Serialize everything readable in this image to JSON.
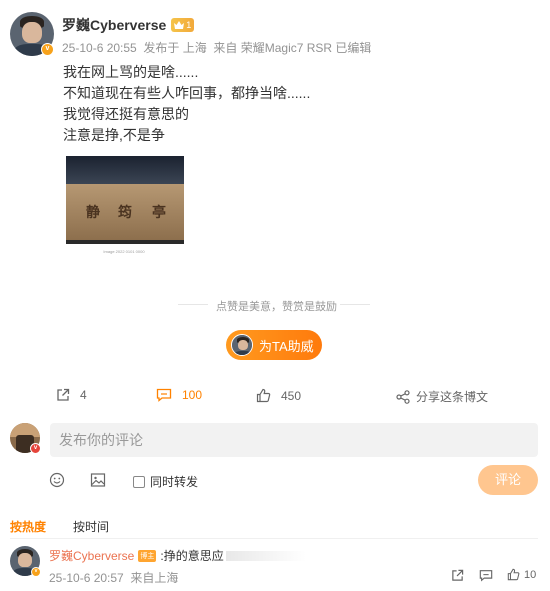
{
  "post": {
    "username": "罗巍Cyberverse",
    "vip_level": "1",
    "meta": "25-10-6 20:55  发布于 上海  来自 荣耀Magic7 RSR 已编辑",
    "lines": [
      "我在网上骂的是啥......",
      "不知道现在有些人咋回事，都挣当啥......",
      "我觉得还挺有意思的",
      "注意是挣,不是争"
    ],
    "image": {
      "sign_chars": [
        "静",
        "筠",
        "亭"
      ],
      "caption": "Image 2022 0101 0000"
    },
    "like_divider_text": "点赞是美意，赞赏是鼓励",
    "support_label": "为TA助威"
  },
  "actions": {
    "repost_count": "4",
    "comment_count": "100",
    "like_count": "450",
    "share_label": "分享这条博文"
  },
  "composer": {
    "placeholder": "发布你的评论",
    "repost_label": "同时转发",
    "submit_label": "评论"
  },
  "sort_tabs": {
    "hot": "按热度",
    "time": "按时间"
  },
  "comment": {
    "username": "罗巍Cyberverse",
    "badge": "博主",
    "text": ":挣的意思应",
    "meta": "25-10-6 20:57  来自上海",
    "like_count": "10"
  },
  "colors": {
    "accent": "#ff8200",
    "username_link": "#eb7350",
    "vip_gold": "#f5c44a"
  },
  "icons": [
    "repost-icon",
    "comment-icon",
    "like-icon",
    "share-icon",
    "emoji-icon",
    "image-icon",
    "verified-badge-icon",
    "vip-crown-icon"
  ]
}
